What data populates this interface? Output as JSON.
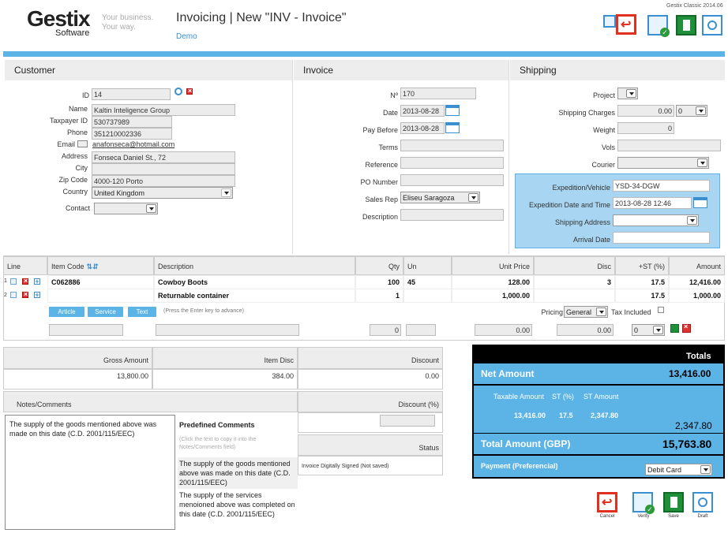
{
  "header": {
    "logo_name": "Gestix",
    "logo_sub": "Software",
    "logo_tag1": "Your business.",
    "logo_tag2": "Your way.",
    "title": "Invoicing | New \"INV - Invoice\"",
    "subtitle": "Demo",
    "version": "Gestix Classic 2014.06"
  },
  "customer": {
    "section": "Customer",
    "id_label": "ID",
    "id": "14",
    "name_label": "Name",
    "name": "Kaltin Inteligence Group",
    "taxpayer_label": "Taxpayer ID",
    "taxpayer": "530737989",
    "phone_label": "Phone",
    "phone": "351210002336",
    "email_label": "Email",
    "email": "anafonseca@hotmail.com",
    "address_label": "Address",
    "address": "Fonseca Daniel St., 72",
    "city_label": "City",
    "city": "",
    "zip_label": "Zip Code",
    "zip": "4000-120 Porto",
    "country_label": "Country",
    "country": "United Kingdom",
    "contact_label": "Contact",
    "contact": ""
  },
  "invoice": {
    "section": "Invoice",
    "no_label": "Nº",
    "no": "170",
    "date_label": "Date",
    "date": "2013-08-28",
    "paybefore_label": "Pay Before",
    "paybefore": "2013-08-28",
    "terms_label": "Terms",
    "terms": "",
    "reference_label": "Reference",
    "reference": "",
    "po_label": "PO Number",
    "po": "",
    "salesrep_label": "Sales Rep",
    "salesrep": "Eliseu Saragoza",
    "desc_label": "Description",
    "desc": ""
  },
  "shipping": {
    "section": "Shipping",
    "project_label": "Project",
    "project": "",
    "charges_label": "Shipping Charges",
    "charges": "0.00",
    "charges_tax": "0",
    "weight_label": "Weight",
    "weight": "0",
    "vols_label": "Vols",
    "vols": "",
    "courier_label": "Courier",
    "courier": "",
    "vehicle_label": "Expedition/Vehicle",
    "vehicle": "YSD-34-DGW",
    "expdate_label": "Expedition Date and Time",
    "expdate": "2013-08-28 12:46",
    "address_label": "Shipping Address",
    "address": "",
    "arrival_label": "Arrival Date",
    "arrival": ""
  },
  "lines": {
    "headers": {
      "line": "Line",
      "code": "Item Code",
      "desc": "Description",
      "qty": "Qty",
      "un": "Un",
      "price": "Unit Price",
      "disc": "Disc",
      "st": "+ST (%)",
      "amount": "Amount"
    },
    "rows": [
      {
        "line": "1",
        "code": "C062886",
        "desc": "Cowboy Boots",
        "qty": "100",
        "un": "45",
        "price": "128.00",
        "disc": "3",
        "st": "17.5",
        "amount": "12,416.00"
      },
      {
        "line": "2",
        "code": "",
        "desc": "Returnable container",
        "qty": "1",
        "un": "",
        "price": "1,000.00",
        "disc": "",
        "st": "17.5",
        "amount": "1,000.00"
      }
    ],
    "btn_article": "Article",
    "btn_service": "Service",
    "btn_text": "Text",
    "hint": "(Press the Enter key to advance)",
    "pricing_label": "Pricing",
    "pricing": "General",
    "taxinc_label": "Tax Included",
    "new_qty": "0",
    "new_price": "0.00",
    "new_disc": "0.00",
    "new_st": "0"
  },
  "summary": {
    "gross_label": "Gross Amount",
    "gross": "13,800.00",
    "itemdisc_label": "Item Disc",
    "itemdisc": "384.00",
    "discount_label": "Discount",
    "discount": "0.00",
    "notes_label": "Notes/Comments",
    "discpct_label": "Discount (%)",
    "notes": "The supply of the goods mentioned above was made on this date (C.D. 2001/115/EEC)",
    "predef_label": "Predefined Comments",
    "predef_hint": "(Click the text to copy it into the Notes/Comments field)",
    "predef1": "The supply of the goods mentioned above was made on this date (C.D. 2001/115/EEC)",
    "predef2": "The supply of the services menoioned above was completed on this date (C.D. 2001/115/EEC)",
    "status_label": "Status",
    "status": "Invoice Digitally Signed (Not saved)"
  },
  "totals": {
    "title": "Totals",
    "net_label": "Net Amount",
    "net": "13,416.00",
    "taxable_label": "Taxable Amount",
    "st_label": "ST (%)",
    "stamt_label": "ST Amount",
    "taxable": "13,416.00",
    "st": "17.5",
    "stamt": "2,347.80",
    "st_total": "2,347.80",
    "total_label": "Total Amount (GBP)",
    "total": "15,763.80",
    "payment_label": "Payment (Preferencial)",
    "payment": "Debit Card"
  },
  "actions": {
    "cancel": "Cancel",
    "verify": "Verify",
    "save": "Save",
    "draft": "Draft"
  },
  "colors": {
    "accent": "#5bb3e6",
    "accent_dark": "#3a8fd0",
    "black": "#000000"
  }
}
